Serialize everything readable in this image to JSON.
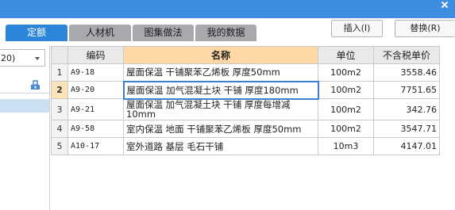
{
  "window": {
    "close_icon": "close-icon"
  },
  "tabs": [
    {
      "label": "定额",
      "active": true
    },
    {
      "label": "人材机",
      "active": false
    },
    {
      "label": "图集做法",
      "active": false
    },
    {
      "label": "我的数据",
      "active": false
    }
  ],
  "toolbar": {
    "insert_label": "插入(I)",
    "replace_label": "替换(R)"
  },
  "left_panel": {
    "select_value": "20)",
    "tree_icon": "tree-node-icon"
  },
  "table": {
    "columns": [
      "编码",
      "名称",
      "单位",
      "不含税单价"
    ],
    "rows": [
      {
        "num": "1",
        "code": "A9-18",
        "name": "屋面保温 干铺聚苯乙烯板 厚度50mm",
        "unit": "100m2",
        "price": "3558.46"
      },
      {
        "num": "2",
        "code": "A9-20",
        "name": "屋面保温 加气混凝土块 干铺 厚度180mm",
        "unit": "100m2",
        "price": "7751.65"
      },
      {
        "num": "3",
        "code": "A9-21",
        "name": "屋面保温 加气混凝土块 干铺 厚度每增减10mm",
        "unit": "100m2",
        "price": "342.76"
      },
      {
        "num": "4",
        "code": "A9-58",
        "name": "室内保温 地面 干铺聚苯乙烯板 厚度50mm",
        "unit": "100m2",
        "price": "3547.71"
      },
      {
        "num": "5",
        "code": "A10-17",
        "name": "室外道路 基层 毛石干铺",
        "unit": "10m3",
        "price": "4147.01"
      }
    ],
    "selected_row": 2
  },
  "colors": {
    "titlebar": "#3d8ee0",
    "active_tab": "#2b86d9",
    "inactive_tab": "#a7a9ac",
    "header_highlight": "#fdd7a6",
    "selection": "#cce0f4"
  }
}
